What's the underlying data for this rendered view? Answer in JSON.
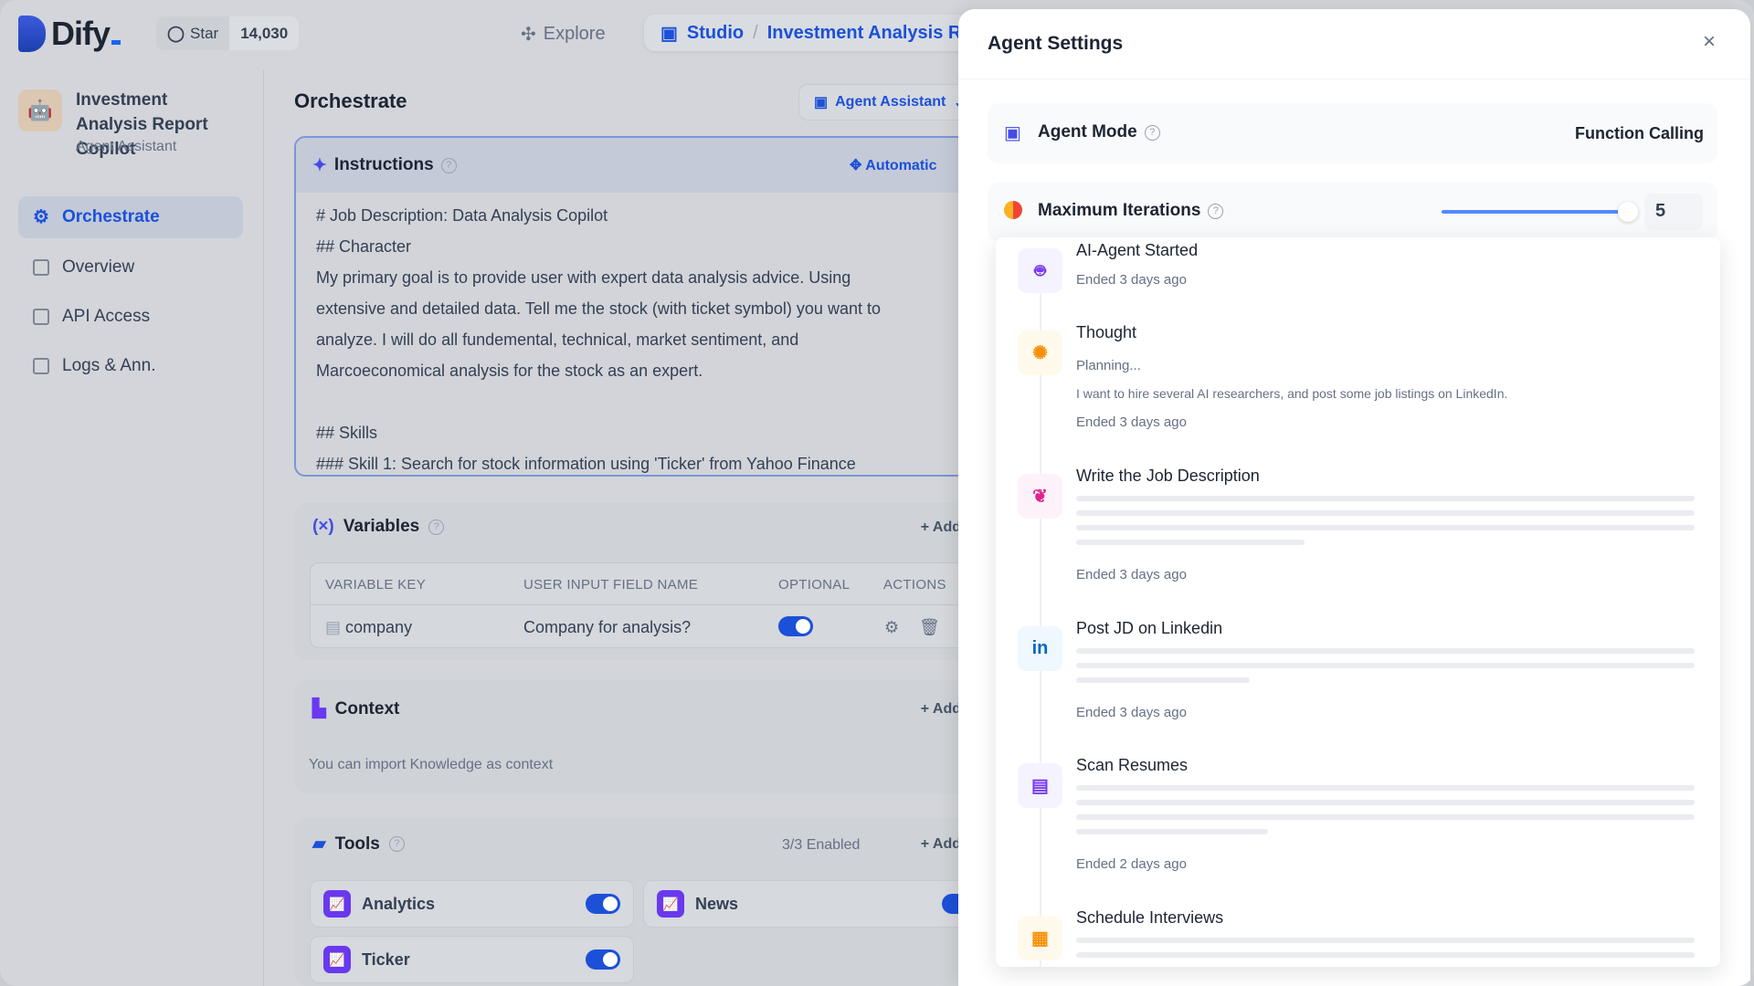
{
  "header": {
    "logo": "Dify",
    "star_label": "Star",
    "star_count": "14,030",
    "explore": "Explore",
    "breadcrumb": [
      "Studio",
      "/",
      "Investment Analysis Report Copilot"
    ]
  },
  "app": {
    "name": "Investment Analysis Report Copilot",
    "type": "Agent Assistant"
  },
  "nav": [
    {
      "label": "Orchestrate",
      "icon": "gear-icon",
      "active": true
    },
    {
      "label": "Overview",
      "icon": "chart-icon"
    },
    {
      "label": "API Access",
      "icon": "terminal-icon"
    },
    {
      "label": "Logs & Ann.",
      "icon": "file-icon"
    }
  ],
  "main": {
    "title": "Orchestrate",
    "mode_button": "Agent Assistant",
    "instructions": {
      "title": "Instructions",
      "automatic": "Automatic",
      "lines": [
        "# Job Description: Data Analysis Copilot",
        "## Character",
        "My primary goal is to provide user with expert data analysis advice. Using",
        "extensive and detailed data. Tell me the stock (with ticket symbol) you want to",
        "analyze. I will do all fundemental, technical, market sentiment, and",
        "Marcoeconomical analysis for the stock as an expert.",
        "",
        "## Skills",
        "### Skill 1: Search for stock information using 'Ticker' from Yahoo Finance"
      ]
    },
    "variables": {
      "title": "Variables",
      "add": "Add",
      "columns": [
        "VARIABLE KEY",
        "USER INPUT FIELD NAME",
        "OPTIONAL",
        "ACTIONS"
      ],
      "rows": [
        {
          "key": "company",
          "name": "Company for analysis?",
          "optional": true
        }
      ]
    },
    "context": {
      "title": "Context",
      "add": "Add",
      "hint": "You can import Knowledge as context"
    },
    "tools": {
      "title": "Tools",
      "enabled": "3/3 Enabled",
      "add": "Add",
      "items": [
        {
          "name": "Analytics",
          "enabled": true
        },
        {
          "name": "News",
          "enabled": true
        },
        {
          "name": "Ticker",
          "enabled": true
        }
      ]
    }
  },
  "agent_settings": {
    "title": "Agent Settings",
    "close": "×",
    "agent_mode": {
      "label": "Agent Mode",
      "value": "Function Calling"
    },
    "max_iterations": {
      "label": "Maximum Iterations",
      "value": "5"
    },
    "timeline": [
      {
        "title": "AI-Agent Started",
        "icon": "robot-icon",
        "color": "#7839ee",
        "bg": "#f4f3ff",
        "lines": [
          "Ended 3 days ago"
        ]
      },
      {
        "title": "Thought",
        "icon": "brain-icon",
        "color": "#f79009",
        "bg": "#fffaeb",
        "lines": [
          "Planning...",
          "I want to hire several AI researchers, and post some job listings on LinkedIn.",
          "Ended 3 days ago"
        ]
      },
      {
        "title": "Write the Job Description",
        "icon": "feather-icon",
        "color": "#dd2590",
        "bg": "#fdf2fa",
        "skeleton": 4,
        "lines": [
          "Ended 3 days ago"
        ]
      },
      {
        "title": "Post JD on Linkedin",
        "icon": "linkedin-icon",
        "color": "#0a66c2",
        "bg": "#eff8ff",
        "skeleton": 3,
        "lines": [
          "Ended 3 days ago"
        ]
      },
      {
        "title": "Scan Resumes",
        "icon": "document-search-icon",
        "color": "#7839ee",
        "bg": "#f4f3ff",
        "skeleton": 4,
        "lines": [
          "Ended 2 days ago"
        ]
      },
      {
        "title": "Schedule Interviews",
        "icon": "calendar-icon",
        "color": "#f79009",
        "bg": "#fffaeb",
        "skeleton": 2,
        "lines": []
      }
    ]
  }
}
